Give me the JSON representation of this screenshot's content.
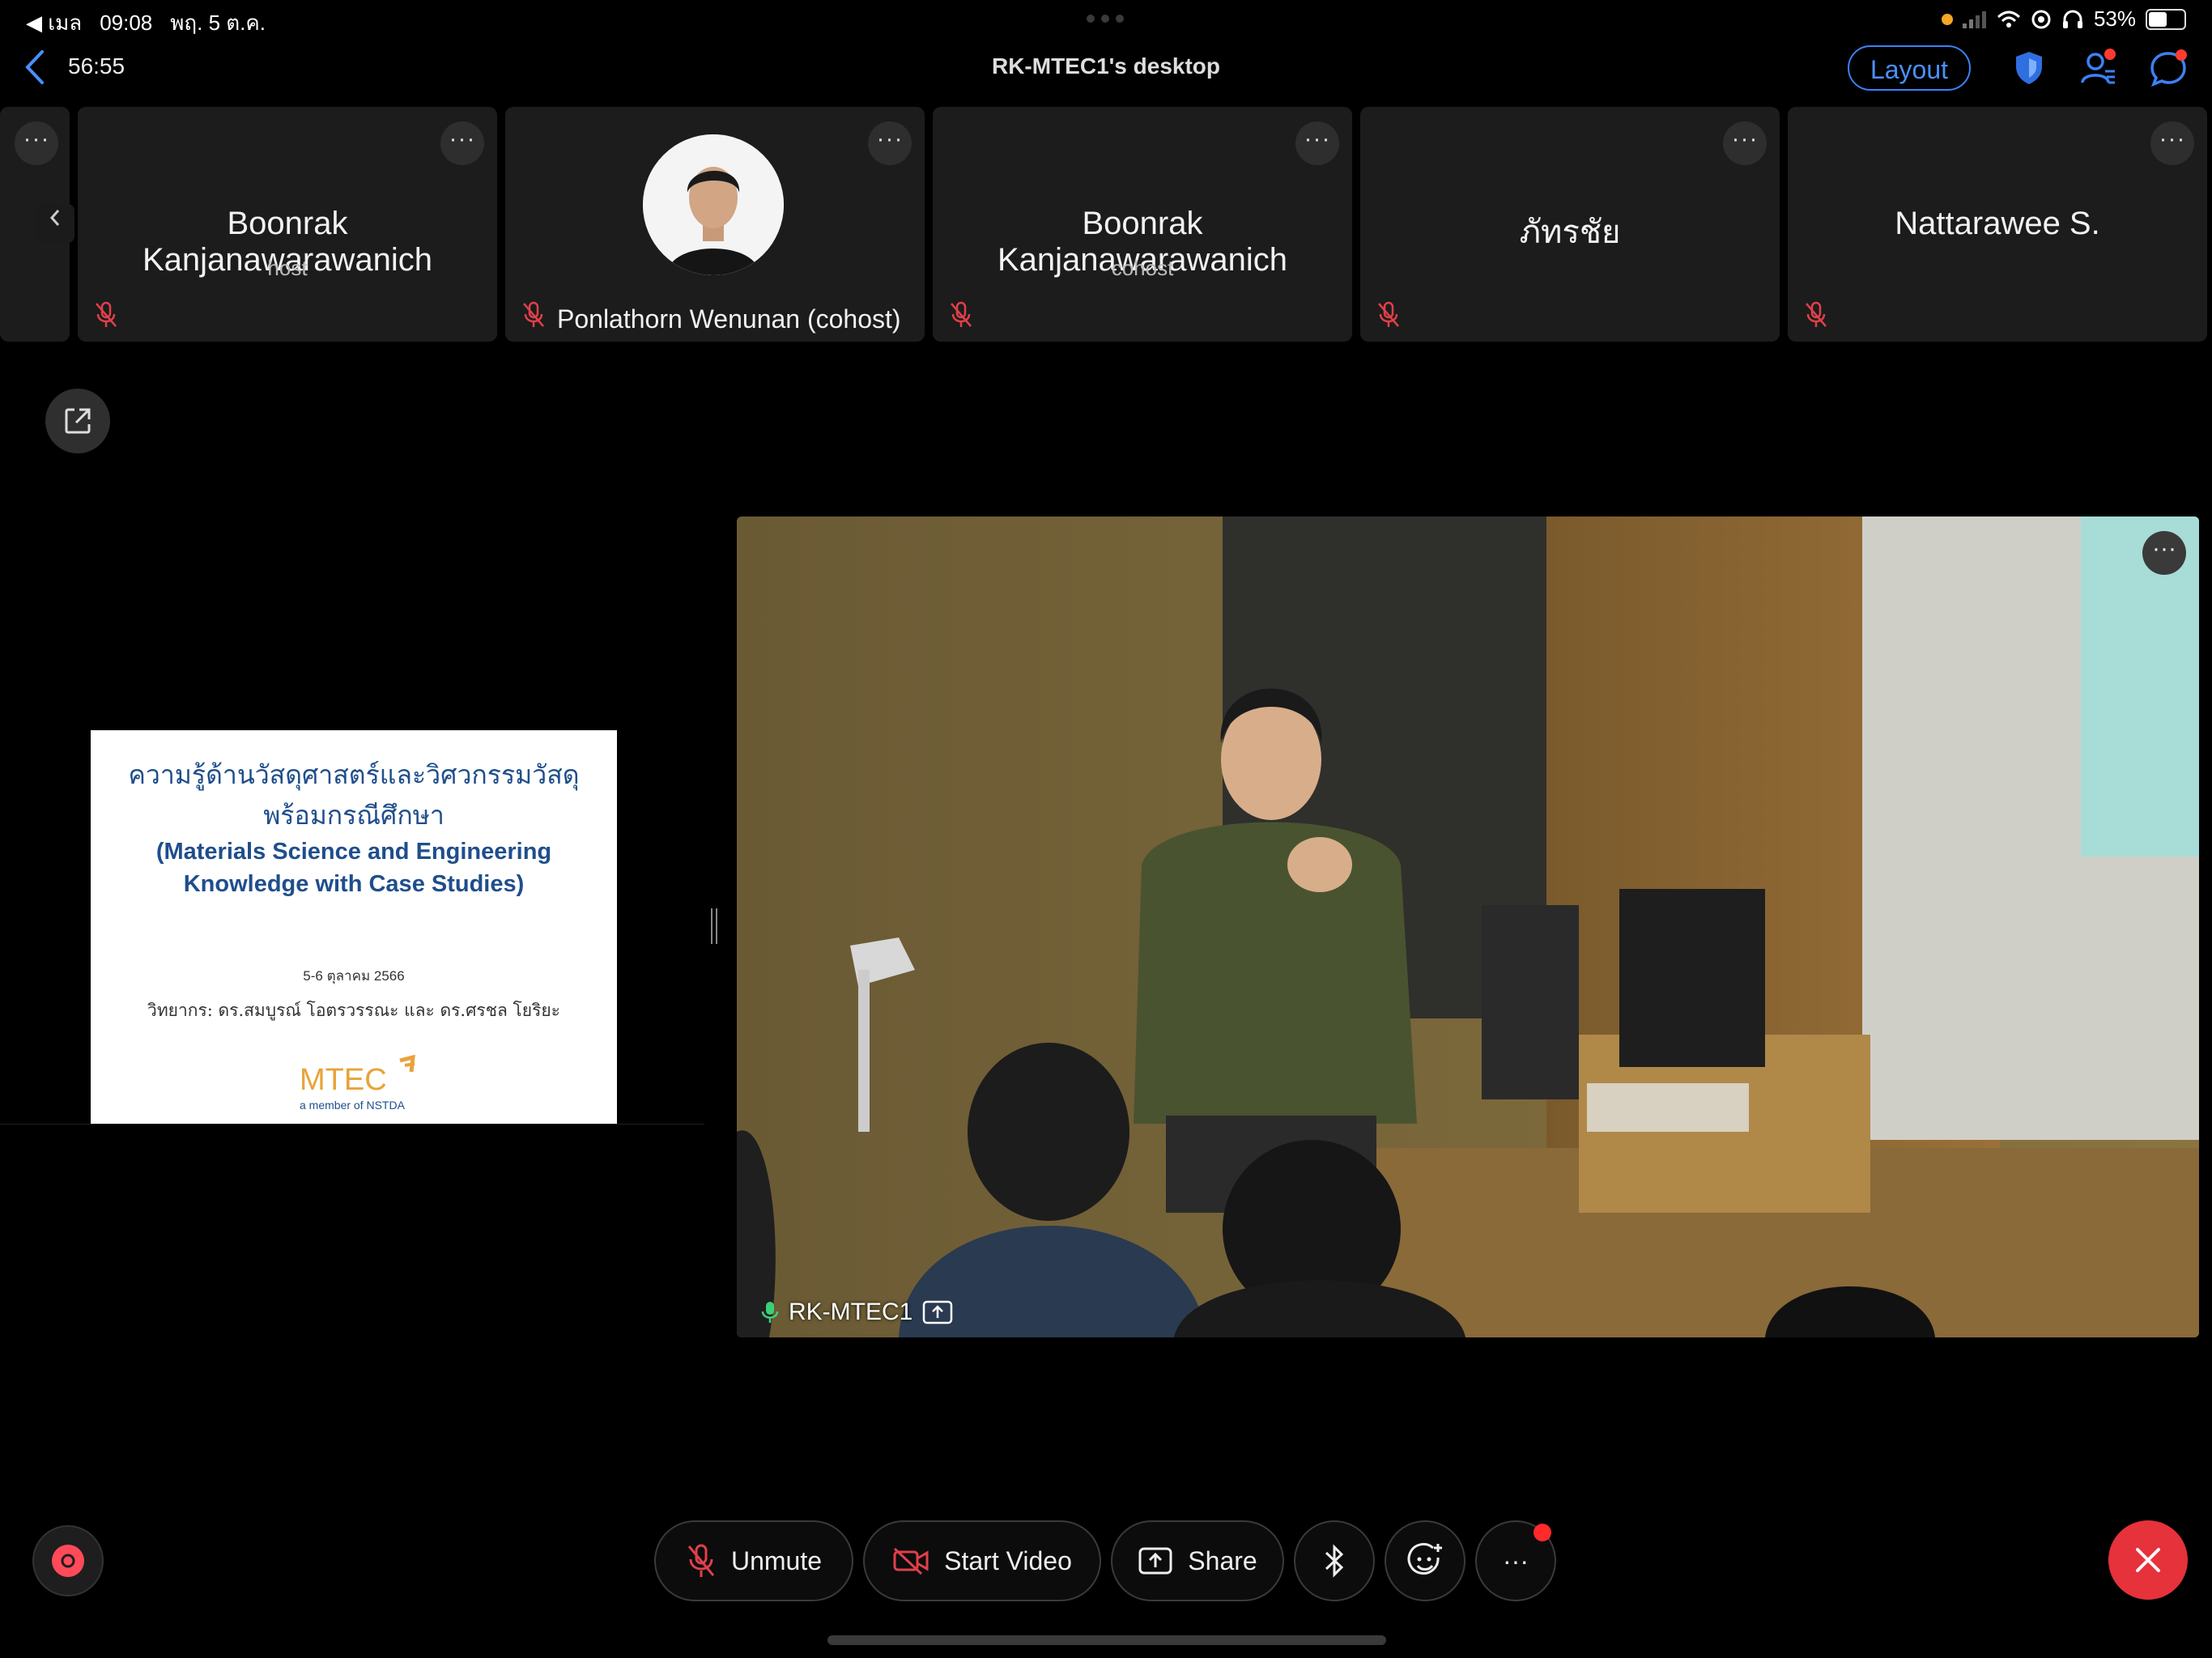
{
  "status_bar": {
    "back_app": "◀ เมล",
    "time": "09:08",
    "date": "พฤ. 5 ต.ค.",
    "battery": "53%"
  },
  "header": {
    "timer": "56:55",
    "title": "RK-MTEC1's desktop",
    "layout_label": "Layout"
  },
  "participants": [
    {
      "name": "Boonrak Kanjanawarawanich",
      "role": "host"
    },
    {
      "name": "Ponlathorn Wenunan (cohost)",
      "role": ""
    },
    {
      "name": "Boonrak Kanjanawarawanich",
      "role": "cohost"
    },
    {
      "name": "ภัทรชัย",
      "role": ""
    },
    {
      "name": "Nattarawee S.",
      "role": ""
    }
  ],
  "more_glyph": "···",
  "slide": {
    "title_thai_1": "ความรู้ด้านวัสดุศาสตร์และวิศวกรรมวัสดุ",
    "title_thai_2": "พร้อมกรณีศึกษา",
    "title_en_1": "(Materials Science and Engineering",
    "title_en_2": "Knowledge with Case Studies)",
    "date": "5-6 ตุลาคม 2566",
    "speaker": "วิทยากร: ดร.สมบูรณ์ โอตรวรรณะ และ ดร.ศรชล โยริยะ",
    "logo_text": "MTEC",
    "logo_sub": "a member of NSTDA"
  },
  "video": {
    "label": "RK-MTEC1"
  },
  "controls": {
    "unmute": "Unmute",
    "start_video": "Start Video",
    "share": "Share"
  },
  "colors": {
    "accent_blue": "#3b82f6",
    "end_red": "#e5323b",
    "muted_red": "#e0404a"
  }
}
